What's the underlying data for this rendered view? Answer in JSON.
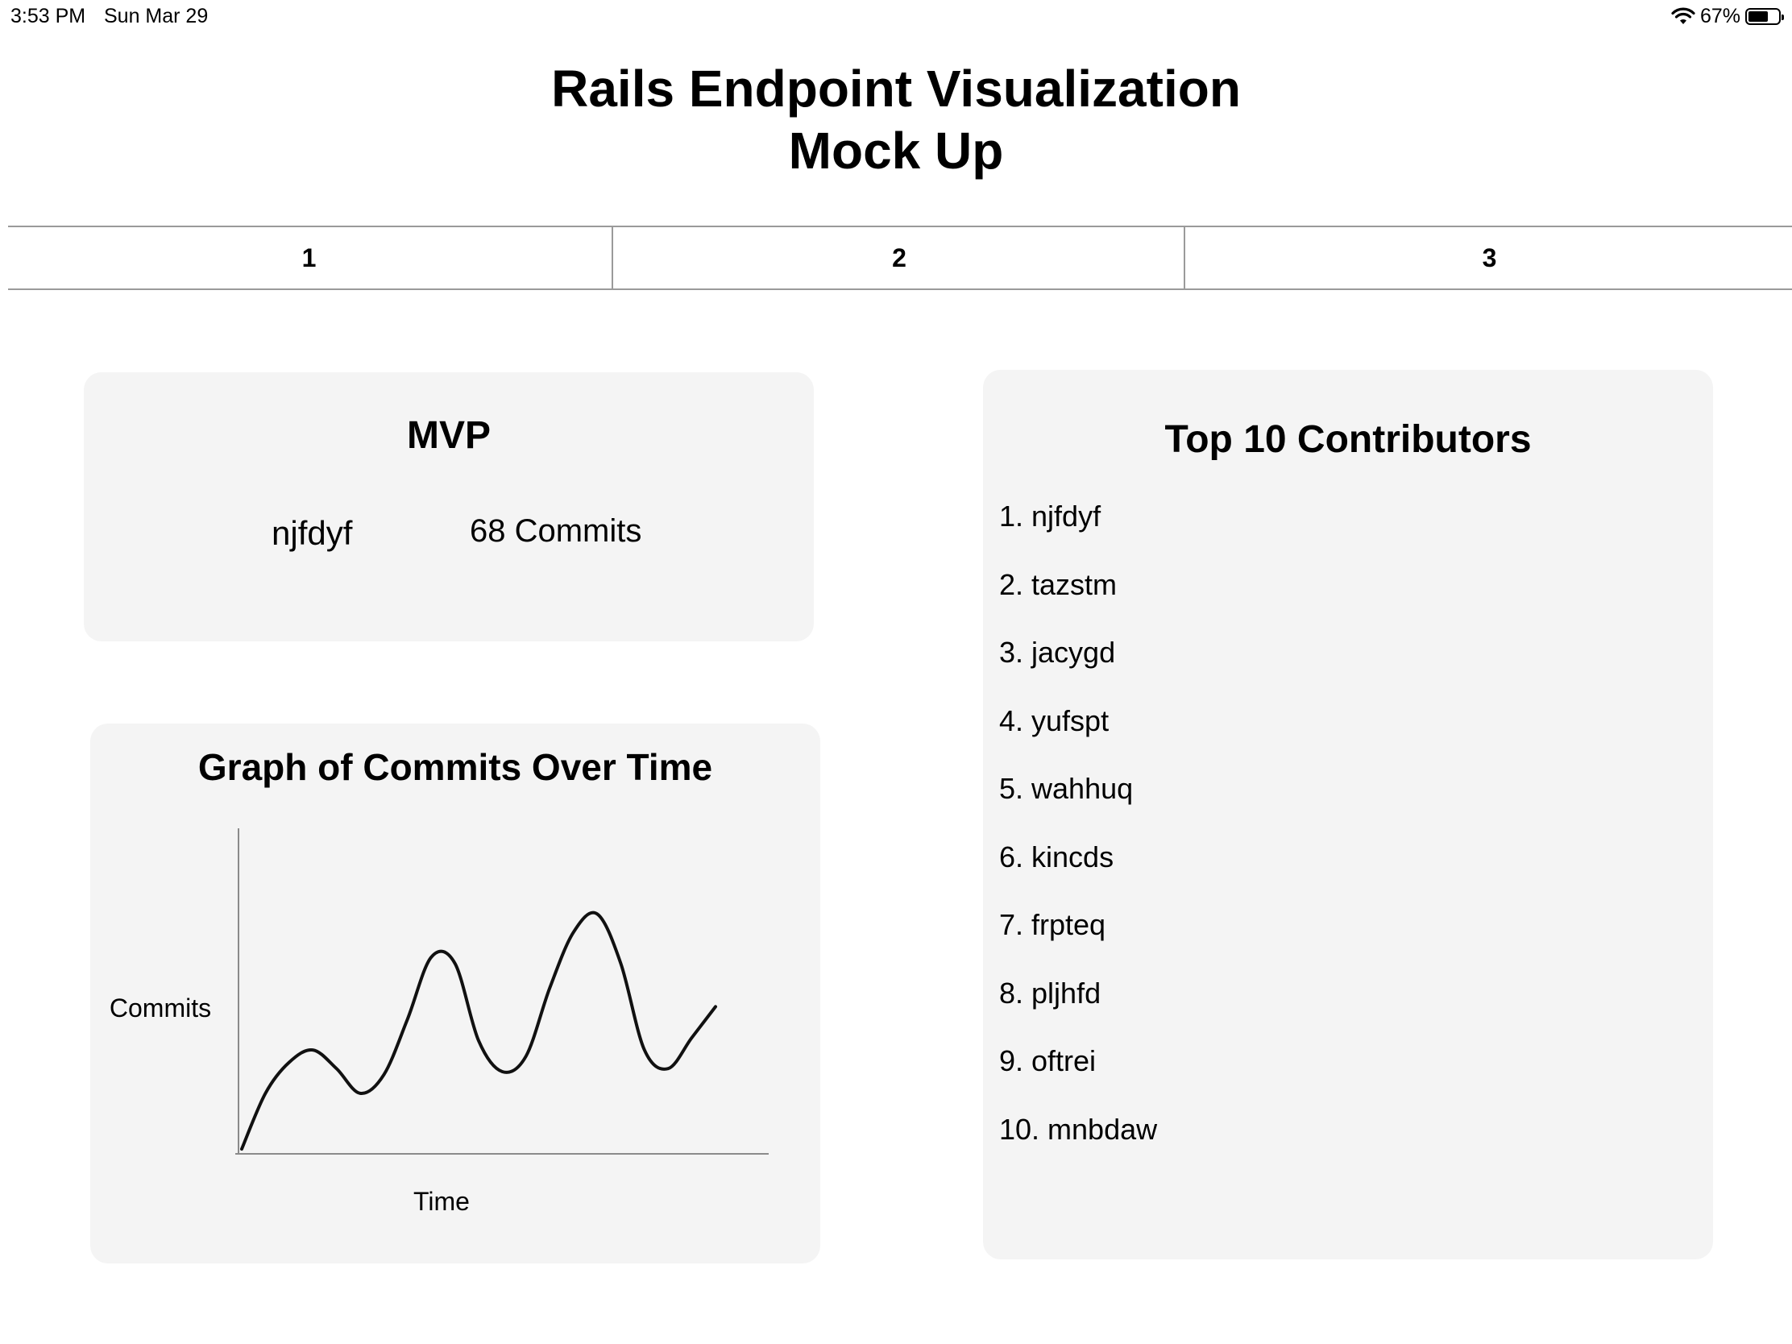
{
  "status_bar": {
    "time": "3:53 PM",
    "date": "Sun Mar 29",
    "battery_percent": "67%",
    "battery_level": 0.67
  },
  "title": {
    "line1": "Rails Endpoint Visualization",
    "line2": "Mock Up"
  },
  "tabs": [
    {
      "label": "1"
    },
    {
      "label": "2"
    },
    {
      "label": "3"
    }
  ],
  "mvp": {
    "title": "MVP",
    "name": "njfdyf",
    "commits": "68 Commits"
  },
  "graph": {
    "title": "Graph of Commits Over Time"
  },
  "chart_data": {
    "type": "line",
    "title": "Graph of Commits Over Time",
    "xlabel": "Time",
    "ylabel": "Commits",
    "note": "hand-drawn sketch, no ticks or numeric labels",
    "x": [
      0,
      5,
      10,
      15,
      20,
      25,
      30,
      35,
      40,
      45,
      50,
      55,
      60,
      65,
      70,
      75,
      80,
      85,
      90,
      95,
      100
    ],
    "y": [
      0,
      18,
      28,
      32,
      26,
      18,
      24,
      42,
      62,
      60,
      35,
      25,
      30,
      52,
      70,
      76,
      60,
      32,
      26,
      36,
      46
    ],
    "ylim": [
      0,
      100
    ],
    "xlim": [
      0,
      100
    ],
    "grid": false
  },
  "contributors": {
    "title": "Top 10 Contributors",
    "items": [
      "1. njfdyf",
      "2. tazstm",
      "3. jacygd",
      "4. yufspt",
      "5. wahhuq",
      "6. kincds",
      "7. frpteq",
      "8. pljhfd",
      "9. oftrei",
      "10. mnbdaw"
    ]
  }
}
